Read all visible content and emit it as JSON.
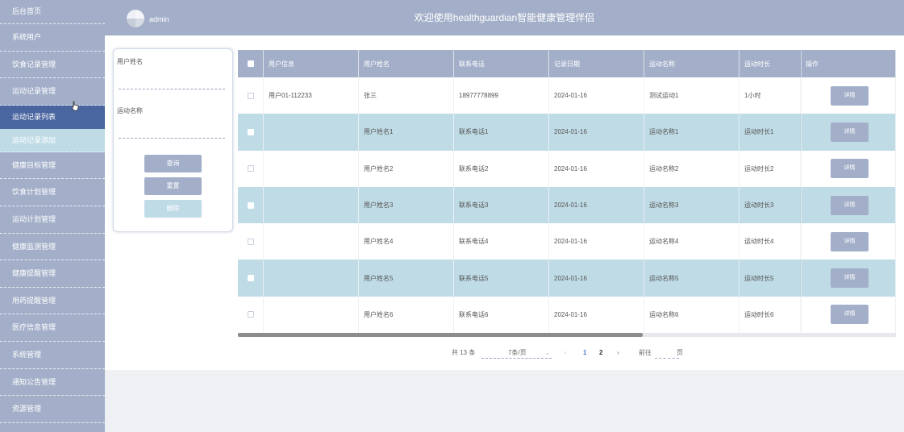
{
  "sidebar": {
    "items": [
      {
        "label": "后台首页"
      },
      {
        "label": "系统用户"
      },
      {
        "label": "饮食记录管理"
      },
      {
        "label": "运动记录管理"
      },
      {
        "label": "运动记录列表"
      },
      {
        "label": "运动记录添加"
      },
      {
        "label": "健康目标管理"
      },
      {
        "label": "饮食计划管理"
      },
      {
        "label": "运动计划管理"
      },
      {
        "label": "健康监测管理"
      },
      {
        "label": "健康提醒管理"
      },
      {
        "label": "用药提醒管理"
      },
      {
        "label": "医疗信息管理"
      },
      {
        "label": "系统管理"
      },
      {
        "label": "通知公告管理"
      },
      {
        "label": "资源管理"
      }
    ]
  },
  "header": {
    "username": "admin",
    "title": "欢迎使用healthguardian智能健康管理伴侣"
  },
  "search": {
    "field1_label": "用户姓名",
    "field1_value": "",
    "field2_label": "运动名称",
    "field2_value": "",
    "query_label": "查询",
    "reset_label": "重置",
    "delete_label": "删除"
  },
  "table": {
    "headers": [
      "用户信息",
      "用户姓名",
      "联系电话",
      "记录日期",
      "运动名称",
      "运动时长",
      "操作"
    ],
    "rows": [
      {
        "info": "用户01-112233",
        "name": "张三",
        "phone": "18977778899",
        "date": "2024-01-16",
        "sport": "测试运动1",
        "duration": "1小时",
        "action": "详情"
      },
      {
        "info": "",
        "name": "用户姓名1",
        "phone": "联系电话1",
        "date": "2024-01-16",
        "sport": "运动名称1",
        "duration": "运动时长1",
        "action": "详情"
      },
      {
        "info": "",
        "name": "用户姓名2",
        "phone": "联系电话2",
        "date": "2024-01-16",
        "sport": "运动名称2",
        "duration": "运动时长2",
        "action": "详情"
      },
      {
        "info": "",
        "name": "用户姓名3",
        "phone": "联系电话3",
        "date": "2024-01-16",
        "sport": "运动名称3",
        "duration": "运动时长3",
        "action": "详情"
      },
      {
        "info": "",
        "name": "用户姓名4",
        "phone": "联系电话4",
        "date": "2024-01-16",
        "sport": "运动名称4",
        "duration": "运动时长4",
        "action": "详情"
      },
      {
        "info": "",
        "name": "用户姓名5",
        "phone": "联系电话5",
        "date": "2024-01-16",
        "sport": "运动名称5",
        "duration": "运动时长5",
        "action": "详情"
      },
      {
        "info": "",
        "name": "用户姓名6",
        "phone": "联系电话6",
        "date": "2024-01-16",
        "sport": "运动名称6",
        "duration": "运动时长6",
        "action": "详情"
      }
    ]
  },
  "pagination": {
    "total": "共 13 条",
    "page_size": "7条/页",
    "prev": "‹",
    "page1": "1",
    "page2": "2",
    "next": "›",
    "goto": "前往",
    "goto_value": "",
    "page_unit": "页"
  },
  "colors": {
    "primary": "#a3afc9",
    "active": "#4a66a0",
    "alt_row": "#bfdbe5"
  }
}
